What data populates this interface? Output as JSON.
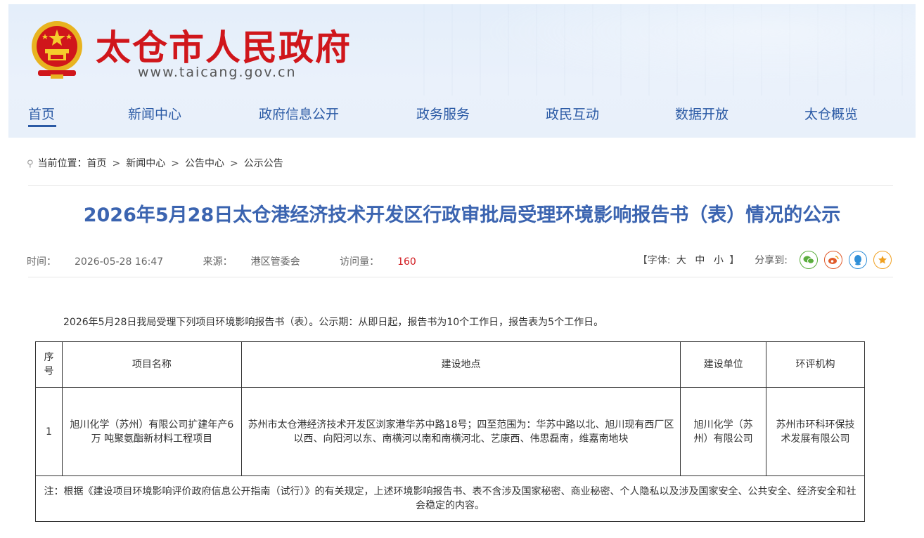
{
  "site": {
    "title": "太仓市人民政府",
    "url": "www.taicang.gov.cn",
    "colors": {
      "brand_red": "#d0161b",
      "nav_blue": "#2b5aa5",
      "title_blue": "#3b64b0"
    }
  },
  "nav": {
    "items": [
      {
        "label": "首页",
        "active": true
      },
      {
        "label": "新闻中心"
      },
      {
        "label": "政府信息公开"
      },
      {
        "label": "政务服务"
      },
      {
        "label": "政民互动"
      },
      {
        "label": "数据开放"
      },
      {
        "label": "太仓概览"
      }
    ]
  },
  "breadcrumb": {
    "prefix": "当前位置：",
    "items": [
      "首页",
      "新闻中心",
      "公告中心",
      "公示公告"
    ],
    "separator": ">"
  },
  "article": {
    "title": "2026年5月28日太仓港经济技术开发区行政审批局受理环境影响报告书（表）情况的公示",
    "time_label": "时间：",
    "time": "2026-05-28 16:47",
    "source_label": "来源：",
    "source": "港区管委会",
    "visits_label": "访问量：",
    "visits": "160",
    "intro": "2026年5月28日我局受理下列项目环境影响报告书（表）。公示期：从即日起，报告书为10个工作日，报告表为5个工作日。"
  },
  "tools": {
    "font_prefix": "【字体:",
    "font_large": "大",
    "font_medium": "中",
    "font_small": "小",
    "font_suffix": "】",
    "share_label": "分享到:",
    "share_icons": [
      "wechat-icon",
      "weibo-icon",
      "qq-icon",
      "favorite-icon"
    ]
  },
  "table": {
    "headers": {
      "no": "序号",
      "name": "项目名称",
      "location": "建设地点",
      "unit": "建设单位",
      "org": "环评机构"
    },
    "rows": [
      {
        "no": "1",
        "name": "旭川化学（苏州）有限公司扩建年产6万 吨聚氨酯新材料工程项目",
        "location": "苏州市太仓港经济技术开发区浏家港华苏中路18号；四至范围为：华苏中路以北、旭川现有西厂区以西、向阳河以东、南横河以南和南横河北、艺康西、伟思磊南，维嘉南地块",
        "unit": "旭川化学（苏州）有限公司",
        "org": "苏州市环科环保技术发展有限公司"
      }
    ],
    "note": "注：根据《建设项目环境影响评价政府信息公开指南（试行）》的有关规定，上述环境影响报告书、表不含涉及国家秘密、商业秘密、个人隐私以及涉及国家安全、公共安全、经济安全和社会稳定的内容。"
  }
}
